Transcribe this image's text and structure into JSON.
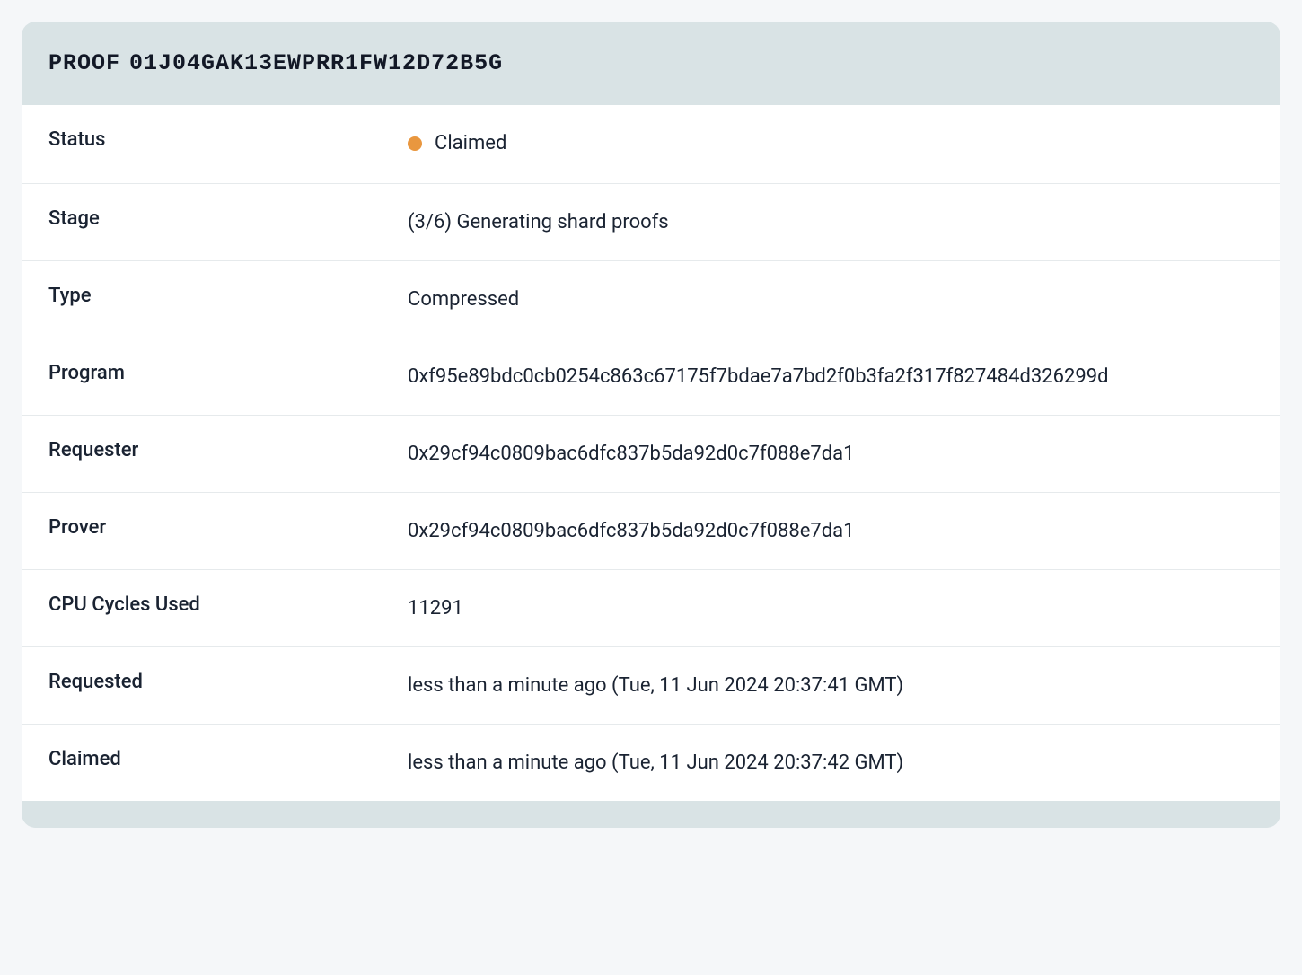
{
  "header": {
    "label": "PROOF",
    "id": "01J04GAK13EWPRR1FW12D72B5G"
  },
  "status": {
    "label": "Status",
    "value": "Claimed",
    "dot_color": "#e9973f"
  },
  "fields": {
    "stage": {
      "label": "Stage",
      "value": "(3/6) Generating shard proofs"
    },
    "type": {
      "label": "Type",
      "value": "Compressed"
    },
    "program": {
      "label": "Program",
      "value": "0xf95e89bdc0cb0254c863c67175f7bdae7a7bd2f0b3fa2f317f827484d326299d"
    },
    "requester": {
      "label": "Requester",
      "value": "0x29cf94c0809bac6dfc837b5da92d0c7f088e7da1"
    },
    "prover": {
      "label": "Prover",
      "value": "0x29cf94c0809bac6dfc837b5da92d0c7f088e7da1"
    },
    "cpu_cycles": {
      "label": "CPU Cycles Used",
      "value": "11291"
    },
    "requested": {
      "label": "Requested",
      "value": "less than a minute ago (Tue, 11 Jun 2024 20:37:41 GMT)"
    },
    "claimed": {
      "label": "Claimed",
      "value": "less than a minute ago (Tue, 11 Jun 2024 20:37:42 GMT)"
    }
  }
}
